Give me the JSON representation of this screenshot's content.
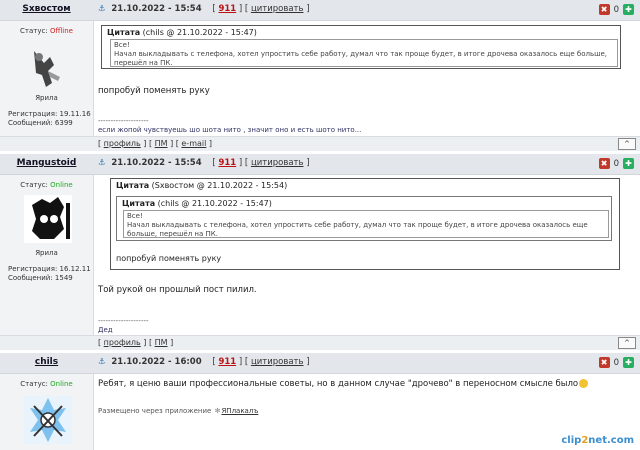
{
  "posts": [
    {
      "author": "Sxвостом",
      "status_label": "Статус:",
      "status": "Offline",
      "rank": "Ярила",
      "reg": "Регистрация: 19.11.16",
      "msgs": "Сообщений: 6399",
      "date": "21.10.2022 - 15:54",
      "num": "911",
      "cite": "цитировать",
      "rating": "0",
      "quote_head_bold": "Цитата",
      "quote_head_rest": " (chils @ 21.10.2022 - 15:47)",
      "quote_text": "Все!\nНачал выкладывать с телефона, хотел упростить себе работу, думал что так проще будет, в итоге дрочева оказалось еще больше, перешёл на ПК.",
      "text": "попробуй поменять руку",
      "sep": "--------------------",
      "sig": "если жопой чувствуешь шо шота нито , значит оно и есть шото нито...",
      "foot": [
        "профиль",
        "ПМ",
        "e-mail"
      ],
      "top": "^"
    },
    {
      "author": "Mangustoid",
      "status_label": "Статус:",
      "status": "Online",
      "rank": "Ярила",
      "reg": "Регистрация: 16.12.11",
      "msgs": "Сообщений: 1549",
      "date": "21.10.2022 - 15:54",
      "num": "911",
      "cite": "цитировать",
      "rating": "0",
      "quote_head_bold": "Цитата",
      "quote_head_rest": " (Sxвостом @ 21.10.2022 - 15:54)",
      "inner_head_bold": "Цитата",
      "inner_head_rest": " (chils @ 21.10.2022 - 15:47)",
      "inner_text": "Все!\nНачал выкладывать с телефона, хотел упростить себе работу, думал что так проще будет, в итоге дрочева оказалось еще больше, перешёл на ПК.",
      "quote_reply": "попробуй поменять руку",
      "text": "Той рукой он прошлый пост пилил.",
      "sep": "--------------------",
      "sig": "Дед",
      "foot": [
        "профиль",
        "ПМ"
      ],
      "top": "^"
    },
    {
      "author": "chils",
      "status_label": "Статус:",
      "status": "Online",
      "date": "21.10.2022 - 16:00",
      "num": "911",
      "cite": "цитировать",
      "rating": "0",
      "text": "Ребят, я ценю ваши профессиональные советы, но в данном случае \"дрочево\" в переносном смысле было",
      "app_note": "Размещено через приложение",
      "app_name": "ЯПлакалъ"
    }
  ],
  "watermark_a": "clip",
  "watermark_b": "2",
  "watermark_c": "net.com"
}
